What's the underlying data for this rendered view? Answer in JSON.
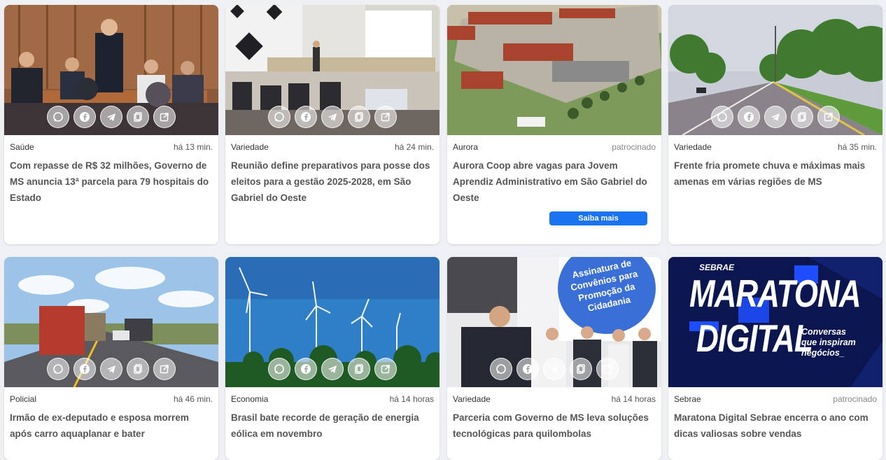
{
  "cards": [
    {
      "category": "Saúde",
      "time": "há 13 min.",
      "title": "Com repasse de R$ 32 milhões, Governo de MS anuncia 13ª parcela para 79 hospitais do Estado"
    },
    {
      "category": "Variedade",
      "time": "há 24 min.",
      "title": "Reunião define preparativos para posse dos eleitos para a gestão 2025-2028, em São Gabriel do Oeste"
    },
    {
      "category": "Aurora",
      "time": "patrocinado",
      "title": "Aurora Coop abre vagas para Jovem Aprendiz Administrativo em São Gabriel do Oeste",
      "cta": "Saiba mais"
    },
    {
      "category": "Variedade",
      "time": "há 35 min.",
      "title": "Frente fria promete chuva e máximas mais amenas em várias regiões de MS"
    },
    {
      "category": "Policial",
      "time": "há 46 min.",
      "title": "Irmão de ex-deputado e esposa morrem após carro aquaplanar e bater"
    },
    {
      "category": "Economia",
      "time": "há 14 horas",
      "title": "Brasil bate recorde de geração de energia eólica em novembro"
    },
    {
      "category": "Variedade",
      "time": "há 14 horas",
      "title": "Parceria com Governo de MS leva soluções tecnológicas para quilombolas",
      "banner": [
        "Assinatura de",
        "Convênios para",
        "Promoção da",
        "Cidadania"
      ]
    },
    {
      "category": "Sebrae",
      "time": "patrocinado",
      "title": "Maratona Digital Sebrae encerra o ano com dicas valiosas sobre vendas",
      "logo": {
        "brand": "SEBRAE",
        "line1": "MARATONA",
        "line2": "DIGITAL",
        "tagline": [
          "Conversas",
          "que inspiram",
          "negócios_"
        ]
      }
    }
  ],
  "share_icons": [
    "whatsapp-icon",
    "facebook-icon",
    "telegram-icon",
    "copy-icon",
    "external-link-icon"
  ],
  "colors": {
    "accent": "#1a73f0",
    "sebrae_bg": "#0b1650",
    "sebrae_accent": "#1e4dff"
  }
}
